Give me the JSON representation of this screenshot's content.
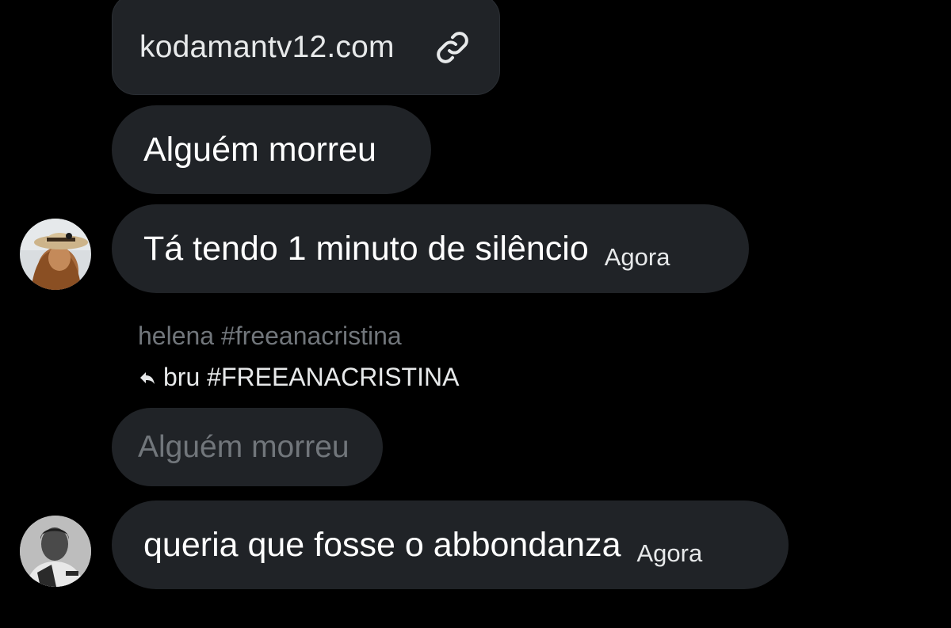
{
  "link_card": {
    "text": "kodamantv12.com",
    "icon": "link-icon"
  },
  "messages": [
    {
      "text": "Alguém morreu"
    },
    {
      "text": "Tá tendo 1 minuto de silêncio",
      "time": "Agora",
      "avatar": "avatar-person-cowboy-hat"
    },
    {
      "text": "queria que fosse o abbondanza",
      "time": "Agora",
      "avatar": "avatar-person-bw"
    }
  ],
  "reply": {
    "author_line": "helena #freeanacristina",
    "replying_to": "bru #FREEANACRISTINA",
    "reply_icon": "reply-arrow-icon",
    "quoted_text": "Alguém morreu"
  },
  "colors": {
    "background": "#000000",
    "bubble": "#202327",
    "secondary_text": "#71767b",
    "primary_text": "#ffffff"
  }
}
